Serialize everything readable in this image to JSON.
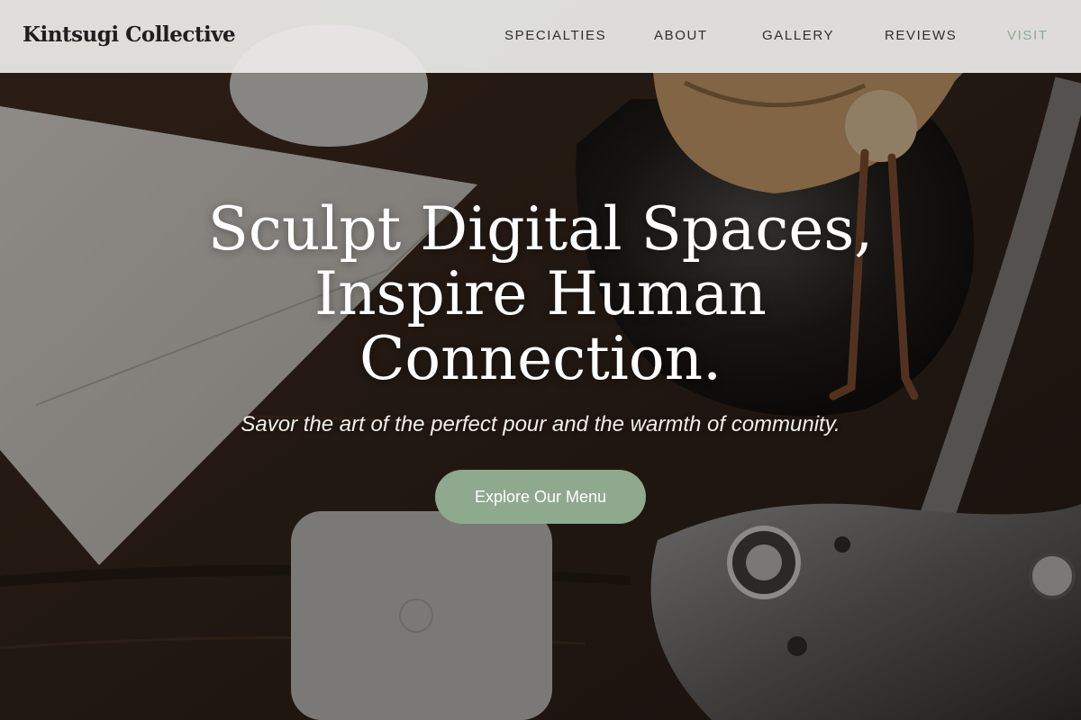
{
  "site": {
    "logo": "Kintsugi Collective"
  },
  "nav": {
    "items": [
      {
        "label": "SPECIALTIES"
      },
      {
        "label": "ABOUT"
      },
      {
        "label": "GALLERY"
      },
      {
        "label": "REVIEWS"
      },
      {
        "label": "VISIT",
        "active": true
      }
    ]
  },
  "hero": {
    "headline_lines": [
      "Sculpt Digital Spaces,",
      "Inspire Human",
      "Connection."
    ],
    "subtitle": "Savor the art of the perfect pour and the warmth of community.",
    "cta_label": "Explore Our Menu",
    "background": "coffee-brewing-scene"
  },
  "colors": {
    "accent": "#8fa996",
    "button": "#8fa98e",
    "nav_background": "#ececea",
    "text_dark": "#1e1e1e"
  }
}
